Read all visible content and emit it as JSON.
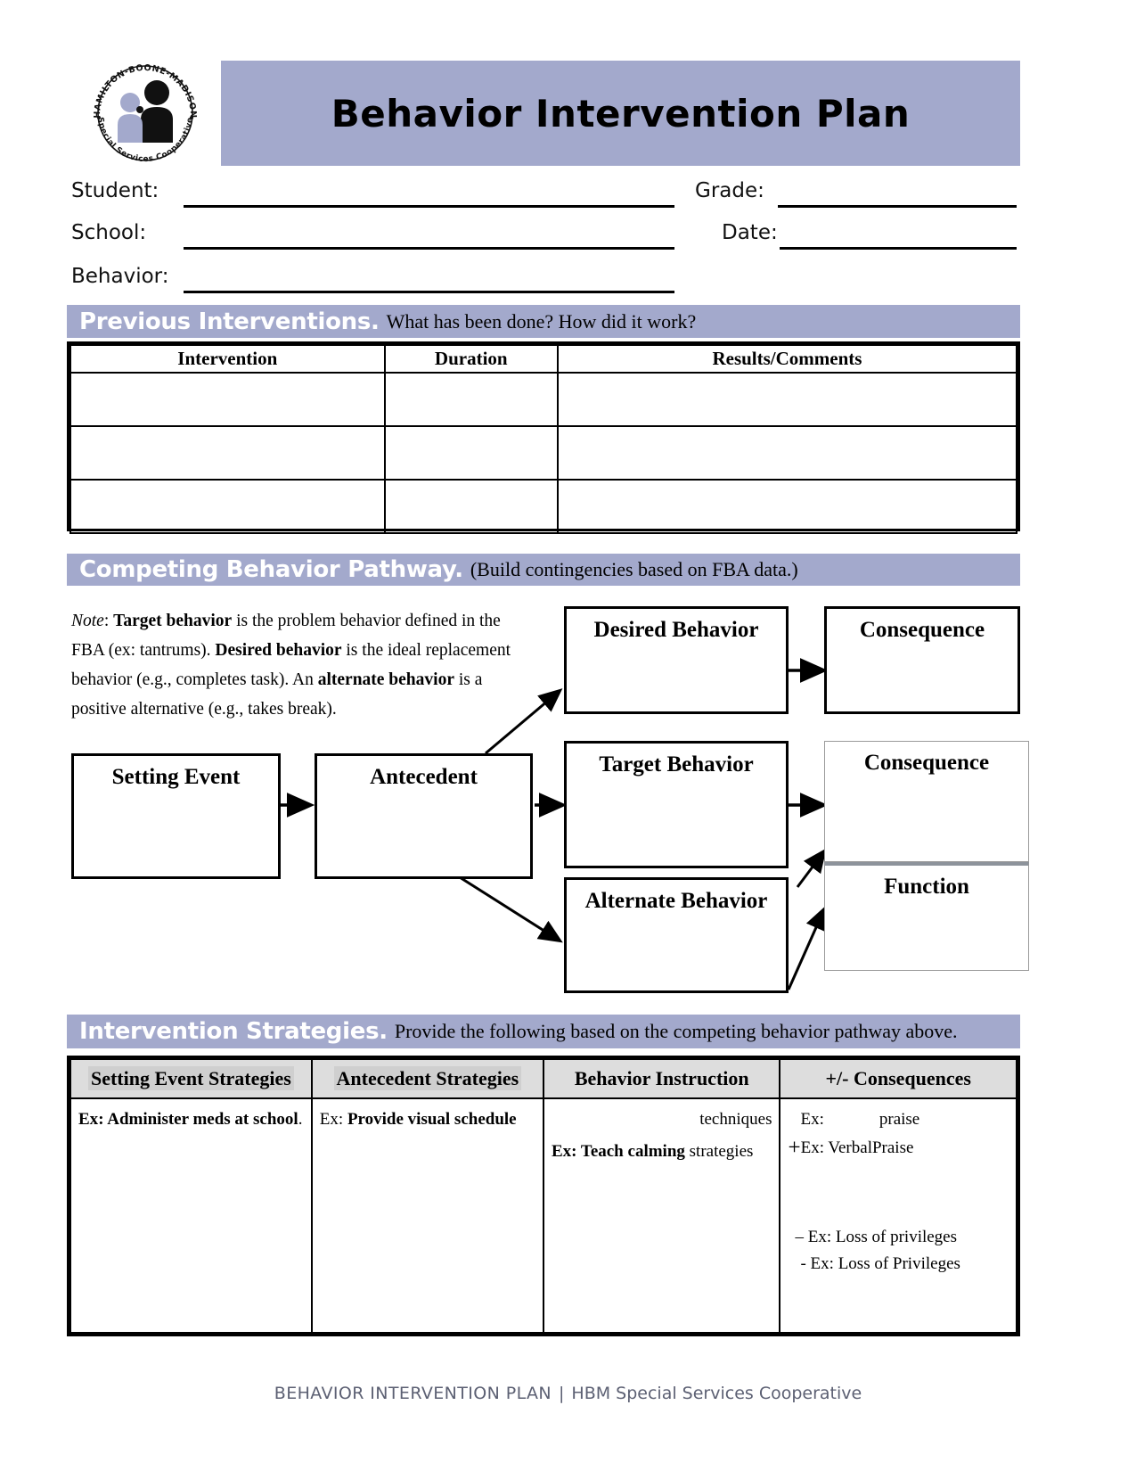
{
  "header": {
    "title": "Behavior Intervention Plan",
    "logo": {
      "top_text": "HAMILTON-BOONE-MADISON",
      "bottom_text": "Special Services Cooperative",
      "icon": "two-figures-silhouette-icon"
    }
  },
  "fields": {
    "student_label": "Student:",
    "school_label": "School:",
    "behavior_label": "Behavior:",
    "grade_label": "Grade:",
    "date_label": "Date:",
    "student_value": "",
    "school_value": "",
    "behavior_value": "",
    "grade_value": "",
    "date_value": ""
  },
  "previous_interventions": {
    "banner_strong": "Previous Interventions.",
    "banner_rest": "What has been done? How did it work?",
    "columns": [
      "Intervention",
      "Duration",
      "Results/Comments"
    ],
    "rows": [
      [
        "",
        "",
        ""
      ],
      [
        "",
        "",
        ""
      ],
      [
        "",
        "",
        ""
      ]
    ]
  },
  "competing_behavior_pathway": {
    "banner_strong": "Competing Behavior Pathway.",
    "banner_rest": "(Build contingencies based on FBA data.)",
    "note": {
      "lead_italic": "Note",
      "text_parts": [
        {
          "t": ": ",
          "s": "n"
        },
        {
          "t": "Target behavior",
          "s": "b"
        },
        {
          "t": " is the problem behavior defined in the FBA (ex: tantrums). ",
          "s": "n"
        },
        {
          "t": "Desired behavior",
          "s": "b"
        },
        {
          "t": " is the ideal replacement behavior (e.g., completes task). An ",
          "s": "n"
        },
        {
          "t": "alternate behavior",
          "s": "b"
        },
        {
          "t": " is a positive alternative (e.g., takes break).",
          "s": "n"
        }
      ]
    },
    "boxes": {
      "setting_event": "Setting Event",
      "antecedent": "Antecedent",
      "desired_behavior": "Desired Behavior",
      "target_behavior": "Target Behavior",
      "alternate_behavior": "Alternate Behavior",
      "consequence_top": "Consequence",
      "consequence_mid": "Consequence",
      "function": "Function"
    }
  },
  "intervention_strategies": {
    "banner_strong": "Intervention Strategies.",
    "banner_rest": "Provide the following based on the competing behavior pathway above.",
    "columns": [
      "Setting Event Strategies",
      "Antecedent Strategies",
      "Behavior Instruction",
      "+/- Consequences"
    ],
    "cells": {
      "setting_event": {
        "prefix": "Ex",
        "sep": ": ",
        "example": "Administer meds at school",
        "suffix": "."
      },
      "antecedent": {
        "prefix": "Ex",
        "sep": ": ",
        "example": "Provide visual schedule"
      },
      "behavior_instruction": {
        "line1": "techniques",
        "line2_prefix": "Ex: Teach ",
        "line2_bold": "calming",
        "line2_suffix": " strategies"
      },
      "consequences": {
        "line1_label": "Ex:",
        "line1_value": "praise",
        "line2_plus": "+",
        "line2_text": "Ex: VerbalPraise",
        "line3_minus": "–",
        "line3_text": "Ex: Loss of privileges",
        "line4_text": "- Ex: Loss of Privileges"
      }
    }
  },
  "footer": {
    "left": "BEHAVIOR INTERVENTION PLAN",
    "separator": "|",
    "right": "HBM Special Services Cooperative"
  },
  "colors": {
    "banner_purple": "#a3a9cc",
    "header_gray": "#dddddd",
    "footer_text": "#5c6073"
  }
}
